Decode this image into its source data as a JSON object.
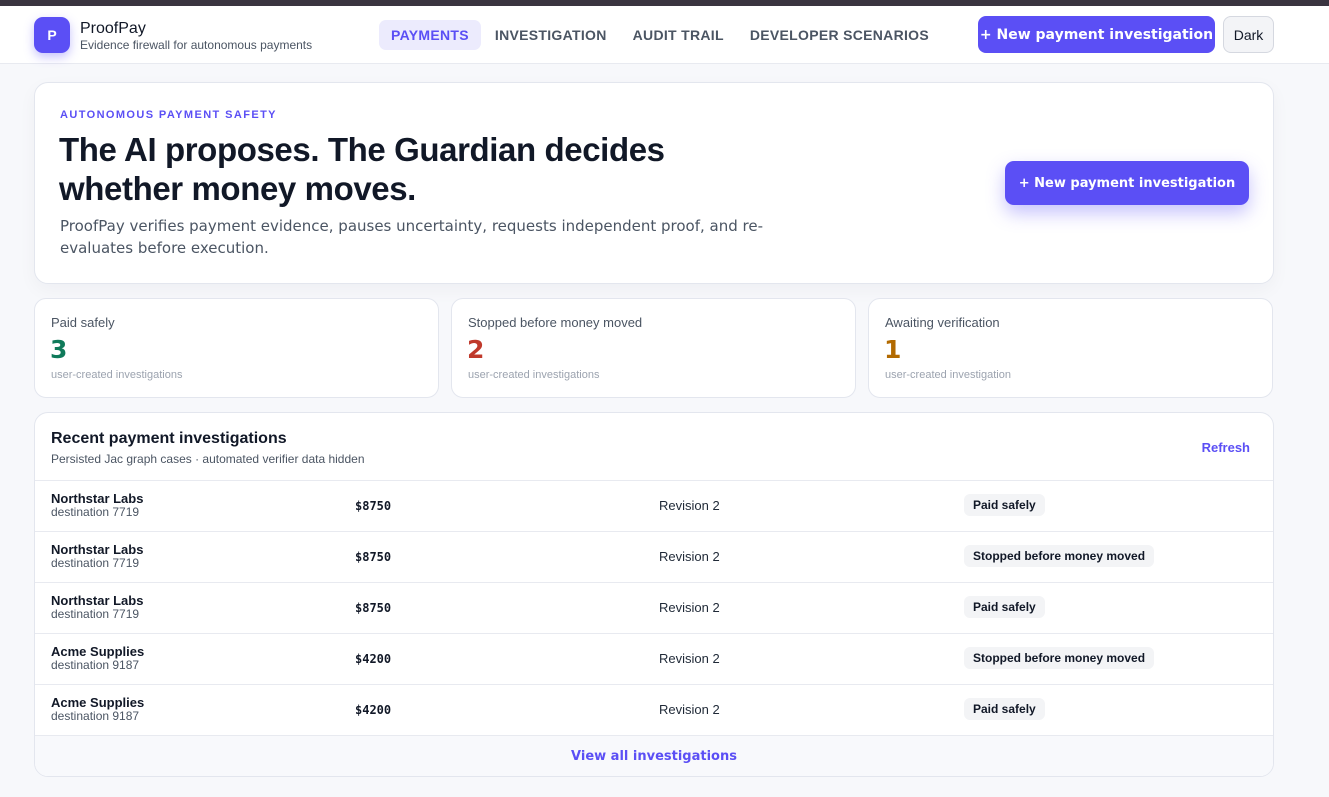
{
  "app": {
    "logo_letter": "P",
    "name": "ProofPay",
    "tagline": "Evidence firewall for autonomous payments"
  },
  "nav": {
    "items": [
      {
        "label": "PAYMENTS",
        "active": true
      },
      {
        "label": "INVESTIGATION",
        "active": false
      },
      {
        "label": "AUDIT TRAIL",
        "active": false
      },
      {
        "label": "DEVELOPER SCENARIOS",
        "active": false
      }
    ]
  },
  "header": {
    "new_button": "+ New payment investigation",
    "theme_button": "Dark"
  },
  "hero": {
    "eyebrow": "AUTONOMOUS PAYMENT SAFETY",
    "title": "The AI proposes. The Guardian decides whether money moves.",
    "description": "ProofPay verifies payment evidence, pauses uncertainty, requests independent proof, and re-evaluates before execution.",
    "button": "+ New payment investigation"
  },
  "stats": [
    {
      "label": "Paid safely",
      "value": "3",
      "sub": "user-created investigations",
      "color": "#0f7a5a"
    },
    {
      "label": "Stopped before money moved",
      "value": "2",
      "sub": "user-created investigations",
      "color": "#c0392b"
    },
    {
      "label": "Awaiting verification",
      "value": "1",
      "sub": "user-created investigation",
      "color": "#b26a00"
    }
  ],
  "recent": {
    "title": "Recent payment investigations",
    "subtitle": "Persisted Jac graph cases · automated verifier data hidden",
    "refresh": "Refresh",
    "rows": [
      {
        "vendor": "Northstar Labs",
        "destination": "destination 7719",
        "amount": "$8750",
        "revision": "Revision 2",
        "status": "Paid safely"
      },
      {
        "vendor": "Northstar Labs",
        "destination": "destination 7719",
        "amount": "$8750",
        "revision": "Revision 2",
        "status": "Stopped before money moved"
      },
      {
        "vendor": "Northstar Labs",
        "destination": "destination 7719",
        "amount": "$8750",
        "revision": "Revision 2",
        "status": "Paid safely"
      },
      {
        "vendor": "Acme Supplies",
        "destination": "destination 9187",
        "amount": "$4200",
        "revision": "Revision 2",
        "status": "Stopped before money moved"
      },
      {
        "vendor": "Acme Supplies",
        "destination": "destination 9187",
        "amount": "$4200",
        "revision": "Revision 2",
        "status": "Paid safely"
      }
    ],
    "view_all": "View all investigations"
  },
  "colors": {
    "accent": "#5b4ff5",
    "paid": "#0f7a5a",
    "stopped": "#c0392b",
    "awaiting": "#b26a00"
  }
}
